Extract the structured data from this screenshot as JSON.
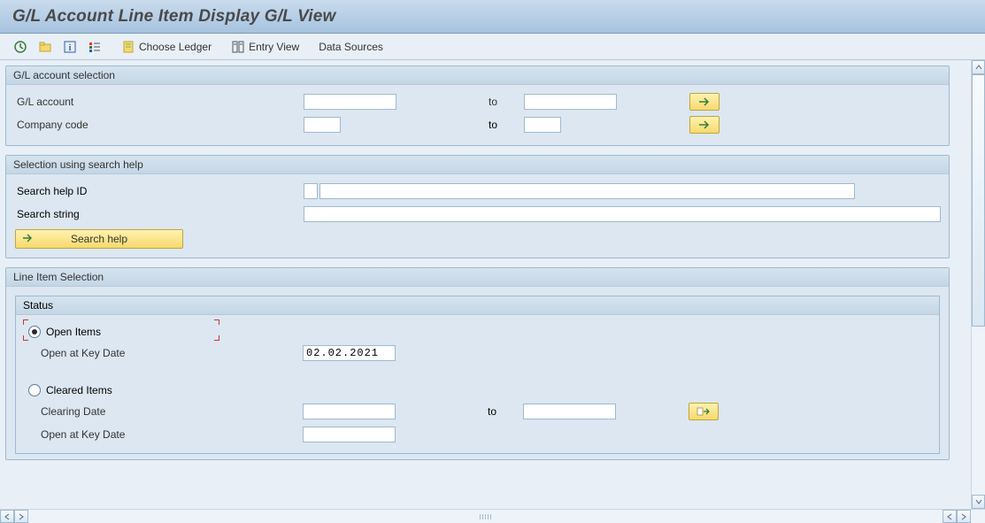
{
  "title": "G/L Account Line Item Display G/L View",
  "toolbar": {
    "choose_ledger": "Choose Ledger",
    "entry_view": "Entry View",
    "data_sources": "Data Sources"
  },
  "groups": {
    "gl_selection": {
      "title": "G/L account selection",
      "gl_account_label": "G/L account",
      "company_code_label": "Company code",
      "to_label": "to",
      "gl_account_from": "",
      "gl_account_to": "",
      "company_code_from": "",
      "company_code_to": ""
    },
    "search_help": {
      "title": "Selection using search help",
      "id_label": "Search help ID",
      "string_label": "Search string",
      "button_label": "Search help",
      "id_value": "",
      "string_value": ""
    },
    "line_item": {
      "title": "Line Item Selection",
      "status_title": "Status",
      "open_items_label": "Open Items",
      "open_key_date_label": "Open at Key Date",
      "open_key_date_value": "02.02.2021",
      "cleared_items_label": "Cleared Items",
      "clearing_date_label": "Clearing Date",
      "clearing_date_from": "",
      "clearing_date_to": "",
      "to_label": "to",
      "cleared_open_key_date_label": "Open at Key Date",
      "cleared_open_key_date_value": ""
    }
  }
}
